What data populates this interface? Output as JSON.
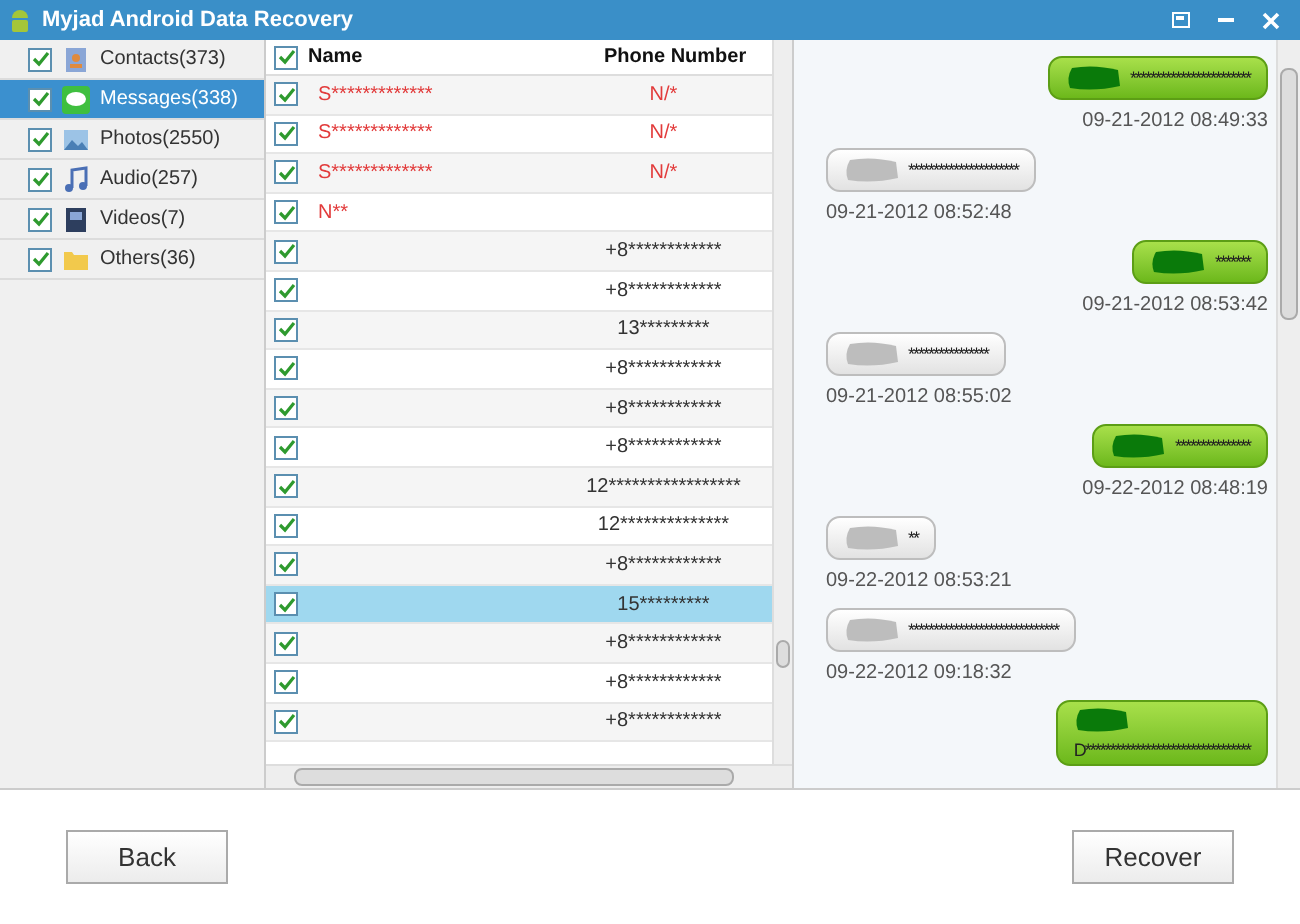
{
  "window": {
    "title": "Myjad Android Data Recovery"
  },
  "sidebar": {
    "items": [
      {
        "label": "Contacts(373)",
        "kind": "contacts",
        "checked": true,
        "selected": false
      },
      {
        "label": "Messages(338)",
        "kind": "messages",
        "checked": true,
        "selected": true
      },
      {
        "label": "Photos(2550)",
        "kind": "photos",
        "checked": true,
        "selected": false
      },
      {
        "label": "Audio(257)",
        "kind": "audio",
        "checked": true,
        "selected": false
      },
      {
        "label": "Videos(7)",
        "kind": "videos",
        "checked": true,
        "selected": false
      },
      {
        "label": "Others(36)",
        "kind": "others",
        "checked": true,
        "selected": false
      }
    ]
  },
  "table": {
    "all_checked": true,
    "columns": [
      "Name",
      "Phone Number"
    ],
    "rows": [
      {
        "name": "S*************",
        "phone": "N/*",
        "unread": true,
        "checked": true,
        "selected": false
      },
      {
        "name": "S*************",
        "phone": "N/*",
        "unread": true,
        "checked": true,
        "selected": false
      },
      {
        "name": "S*************",
        "phone": "N/*",
        "unread": true,
        "checked": true,
        "selected": false
      },
      {
        "name": "N**",
        "unread": true,
        "checked": true,
        "selected": false
      },
      {
        "phone": "+8************",
        "unread": false,
        "checked": true,
        "selected": false
      },
      {
        "phone": "+8************",
        "unread": false,
        "checked": true,
        "selected": false
      },
      {
        "phone": "13*********",
        "unread": false,
        "checked": true,
        "selected": false
      },
      {
        "phone": "+8************",
        "unread": false,
        "checked": true,
        "selected": false
      },
      {
        "phone": "+8************",
        "unread": false,
        "checked": true,
        "selected": false
      },
      {
        "phone": "+8************",
        "unread": false,
        "checked": true,
        "selected": false
      },
      {
        "phone": "12*****************",
        "unread": false,
        "checked": true,
        "selected": false
      },
      {
        "phone": "12**************",
        "unread": false,
        "checked": true,
        "selected": false
      },
      {
        "phone": "+8************",
        "unread": false,
        "checked": true,
        "selected": false
      },
      {
        "phone": "15*********",
        "unread": false,
        "checked": true,
        "selected": true
      },
      {
        "phone": "+8************",
        "unread": false,
        "checked": true,
        "selected": false
      },
      {
        "phone": "+8************",
        "unread": false,
        "checked": true,
        "selected": false
      },
      {
        "phone": "+8************",
        "unread": false,
        "checked": true,
        "selected": false
      }
    ]
  },
  "messages": [
    {
      "kind": "sent",
      "text": "************************",
      "time": "09-21-2012 08:49:33"
    },
    {
      "kind": "received",
      "text": "**********************",
      "time": "09-21-2012 08:52:48"
    },
    {
      "kind": "sent",
      "text": "*******",
      "time": "09-21-2012 08:53:42"
    },
    {
      "kind": "received",
      "text": "****************",
      "time": "09-21-2012 08:55:02"
    },
    {
      "kind": "sent",
      "text": "***************",
      "time": "09-22-2012 08:48:19"
    },
    {
      "kind": "received",
      "text": "**",
      "time": "09-22-2012 08:53:21"
    },
    {
      "kind": "received",
      "text": "******************************",
      "time": "09-22-2012 09:18:32"
    },
    {
      "kind": "sent_long",
      "text": "D*********************************"
    }
  ],
  "buttons": [
    "Back",
    "Recover"
  ]
}
